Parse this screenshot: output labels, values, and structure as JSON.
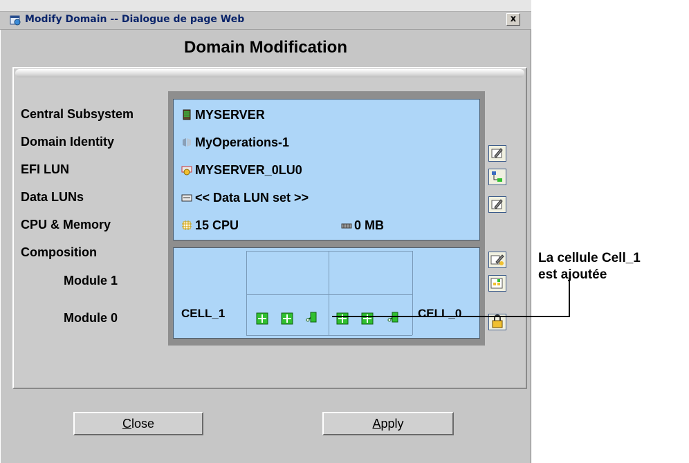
{
  "window": {
    "title": "Modify Domain -- Dialogue de page Web",
    "close_glyph": "x",
    "heading": "Domain Modification"
  },
  "labels": {
    "central_subsystem": "Central Subsystem",
    "domain_identity": "Domain Identity",
    "efi_lun": "EFI LUN",
    "data_luns": "Data LUNs",
    "cpu_memory": "CPU & Memory",
    "composition": "Composition",
    "module_1": "Module 1",
    "module_0": "Module 0"
  },
  "values": {
    "central_subsystem": "MYSERVER",
    "domain_identity": "MyOperations-1",
    "efi_lun": "MYSERVER_0LU0",
    "data_luns": "<< Data LUN set >>",
    "cpu": "15 CPU",
    "memory": "0 MB"
  },
  "composition": {
    "cell_left": "CELL_1",
    "cell_right": "CELL_0"
  },
  "buttons": {
    "close_prefix": "C",
    "close_rest": "lose",
    "apply_prefix": "A",
    "apply_rest": "pply"
  },
  "callout": {
    "line1": "La cellule Cell_1",
    "line2": "est ajoutée"
  },
  "icons": {
    "app": "web-dialog-icon",
    "server": "server-icon",
    "domain": "domain-icon",
    "efi": "disk-icon",
    "data_lun": "lun-icon",
    "cpu": "cpu-icon",
    "memory": "memory-icon"
  },
  "colors": {
    "panel_blue": "#aed6f8",
    "window_gray": "#c6c6c6",
    "title_blue": "#0a246a"
  }
}
